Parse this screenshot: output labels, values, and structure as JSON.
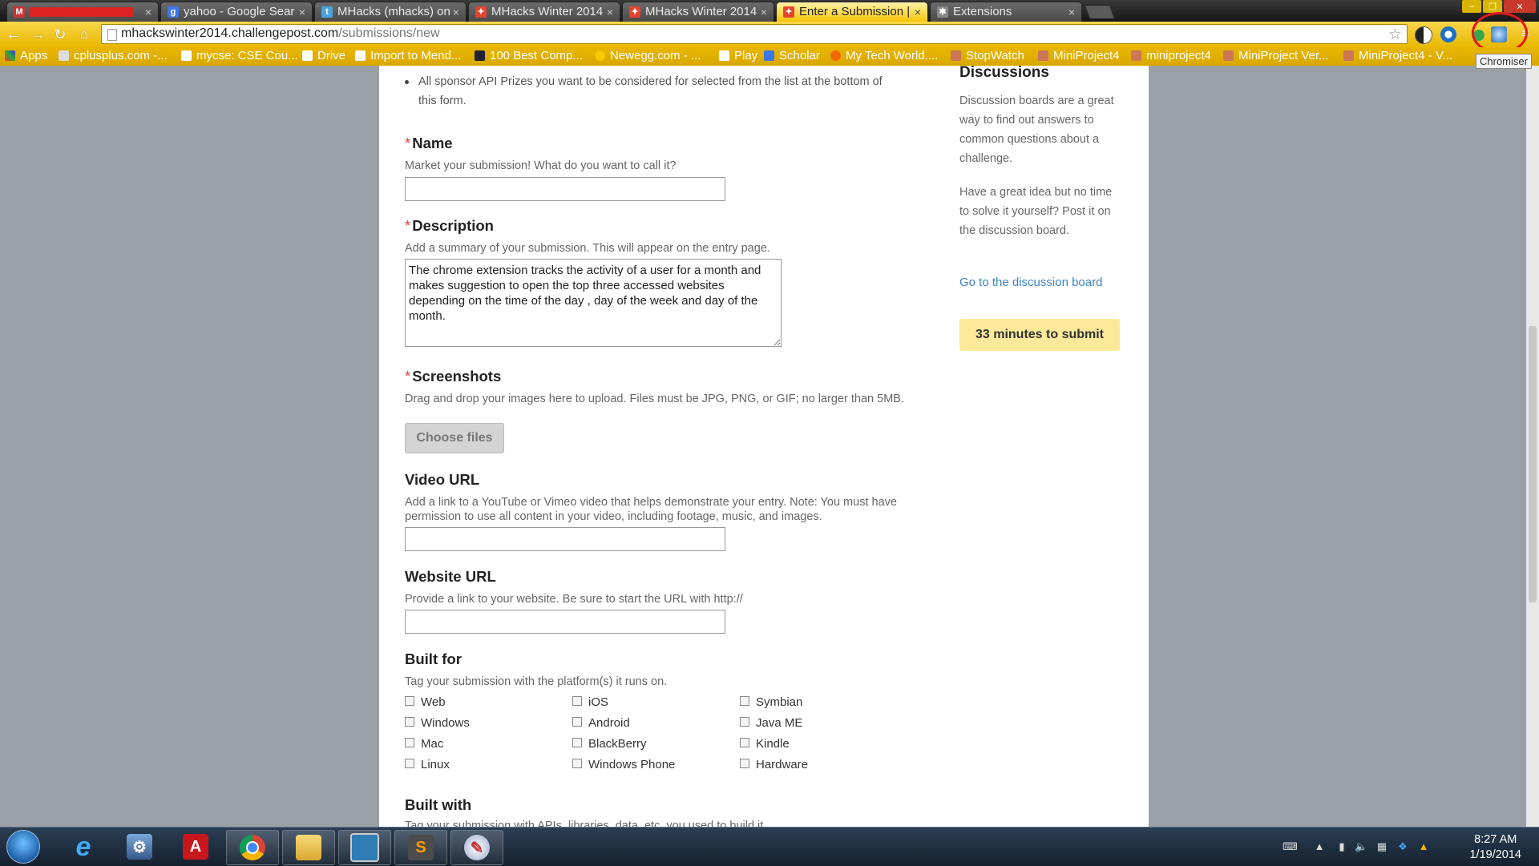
{
  "browser": {
    "tabs": [
      {
        "label": "",
        "favicon": "gmail-icon",
        "active": false
      },
      {
        "label": "yahoo - Google Sear",
        "favicon": "google-icon",
        "active": false
      },
      {
        "label": "MHacks (mhacks) on",
        "favicon": "twitter-icon",
        "active": false
      },
      {
        "label": "MHacks Winter 2014",
        "favicon": "challengepost-icon",
        "active": false
      },
      {
        "label": "MHacks Winter 2014",
        "favicon": "challengepost-icon",
        "active": false
      },
      {
        "label": "Enter a Submission |",
        "favicon": "challengepost-icon",
        "active": true
      },
      {
        "label": "Extensions",
        "favicon": "puzzle-icon",
        "active": false
      }
    ],
    "url_host": "mhackswinter2014.challengepost.com",
    "url_path": "/submissions/new",
    "extension_tooltip": "Chromiser",
    "bookmarks": [
      "Apps",
      "cplusplus.com -...",
      "mycse: CSE Cou...",
      "Drive",
      "Import to Mend...",
      "100 Best Comp...",
      "Newegg.com - ...",
      "Play",
      "Scholar",
      "My Tech World....",
      "StopWatch",
      "MiniProject4",
      "miniproject4",
      "MiniProject Ver...",
      "MiniProject4 - V..."
    ]
  },
  "form": {
    "intro_bullet": "All sponsor API Prizes you want to be considered for selected from the list at the bottom of this form.",
    "required_mark": "*",
    "name": {
      "label": "Name",
      "help": "Market your submission! What do you want to call it?",
      "value": ""
    },
    "description": {
      "label": "Description",
      "help": "Add a summary of your submission. This will appear on the entry page.",
      "value": "The chrome extension tracks the activity of a user for a month and makes suggestion to open the top three accessed websites depending on the time of the day , day of the week and day of the month."
    },
    "screenshots": {
      "label": "Screenshots",
      "help": "Drag and drop your images here to upload. Files must be JPG, PNG, or GIF; no larger than 5MB.",
      "button": "Choose files"
    },
    "video_url": {
      "label": "Video URL",
      "help": "Add a link to a YouTube or Vimeo video that helps demonstrate your entry. Note: You must have permission to use all content in your video, including footage, music, and images.",
      "value": ""
    },
    "website_url": {
      "label": "Website URL",
      "help": "Provide a link to your website. Be sure to start the URL with http://",
      "value": ""
    },
    "built_for": {
      "label": "Built for",
      "help": "Tag your submission with the platform(s) it runs on.",
      "platforms": [
        [
          "Web",
          "iOS",
          "Symbian"
        ],
        [
          "Windows",
          "Android",
          "Java ME"
        ],
        [
          "Mac",
          "BlackBerry",
          "Kindle"
        ],
        [
          "Linux",
          "Windows Phone",
          "Hardware"
        ]
      ]
    },
    "built_with": {
      "label": "Built with",
      "help": "Tag your submission with APIs, libraries, data, etc. you used to build it."
    }
  },
  "sidebar": {
    "title": "Discussions",
    "p1": "Discussion boards are a great way to find out answers to common questions about a challenge.",
    "p2": "Have a great idea but no time to solve it yourself? Post it on the discussion board.",
    "link": "Go to the discussion board",
    "timer": "33 minutes to submit"
  },
  "taskbar": {
    "time": "8:27 AM",
    "date": "1/19/2014"
  }
}
